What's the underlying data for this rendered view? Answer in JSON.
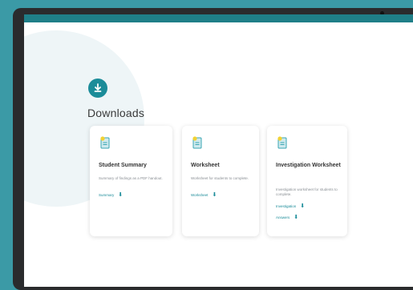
{
  "topbar": {
    "brand": ""
  },
  "section": {
    "title": "Downloads",
    "icon": "download-icon"
  },
  "colors": {
    "accent": "#1b8c99",
    "frame": "#3b9aa6",
    "bezel": "#2a2b2d"
  },
  "cards": [
    {
      "title": "Student Summary",
      "description": "Summary of findings as a PDF handout.",
      "icon": "document-icon",
      "links": [
        {
          "label": "Summary",
          "icon": "download-arrow-icon"
        }
      ]
    },
    {
      "title": "Worksheet",
      "description": "Worksheet for students to complete.",
      "icon": "document-icon",
      "links": [
        {
          "label": "Worksheet",
          "icon": "download-arrow-icon"
        }
      ]
    },
    {
      "title": "Investigation Worksheet",
      "description": "Investigation worksheet for students to complete.",
      "icon": "document-icon",
      "links": [
        {
          "label": "Investigation",
          "icon": "download-arrow-icon"
        },
        {
          "label": "Answers",
          "icon": "download-arrow-icon"
        }
      ]
    }
  ]
}
